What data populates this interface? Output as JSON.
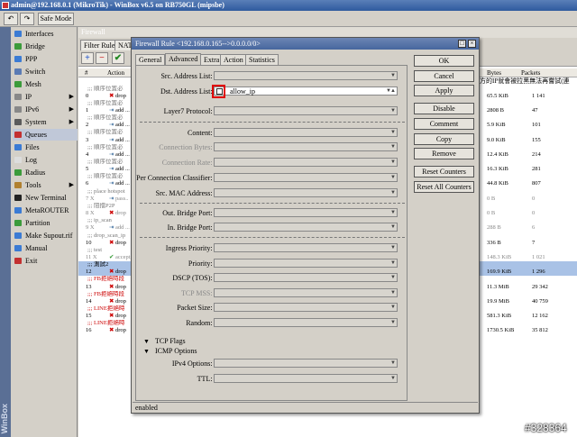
{
  "window_title": "admin@192.168.0.1 (MikroTik) - WinBox v6.5 on RB750GL (mipsbe)",
  "toolbar": {
    "safe_mode": "Safe Mode"
  },
  "sidebar": {
    "brand": "WinBox",
    "items": [
      {
        "label": "Interfaces",
        "icon": "interfaces-icon",
        "color": "#3b7bd4"
      },
      {
        "label": "Bridge",
        "icon": "bridge-icon",
        "color": "#3b9b3b"
      },
      {
        "label": "PPP",
        "icon": "ppp-icon",
        "color": "#3b7bd4"
      },
      {
        "label": "Switch",
        "icon": "switch-icon",
        "color": "#5b7bb4"
      },
      {
        "label": "Mesh",
        "icon": "mesh-icon",
        "color": "#3b9b3b"
      },
      {
        "label": "IP",
        "icon": "ip-icon",
        "color": "#888888",
        "arrow": true
      },
      {
        "label": "IPv6",
        "icon": "ipv6-icon",
        "color": "#888888",
        "arrow": true
      },
      {
        "label": "System",
        "icon": "system-icon",
        "color": "#5b5b5b",
        "arrow": true
      },
      {
        "label": "Queues",
        "icon": "queues-icon",
        "color": "#c33030",
        "selected": true
      },
      {
        "label": "Files",
        "icon": "files-icon",
        "color": "#3b7bd4"
      },
      {
        "label": "Log",
        "icon": "log-icon",
        "color": "#dddddd"
      },
      {
        "label": "Radius",
        "icon": "radius-icon",
        "color": "#3b9b3b"
      },
      {
        "label": "Tools",
        "icon": "tools-icon",
        "color": "#b08030",
        "arrow": true
      },
      {
        "label": "New Terminal",
        "icon": "terminal-icon",
        "color": "#222222"
      },
      {
        "label": "MetaROUTER",
        "icon": "metarouter-icon",
        "color": "#3b7bd4"
      },
      {
        "label": "Partition",
        "icon": "partition-icon",
        "color": "#3b9b3b"
      },
      {
        "label": "Make Supout.rif",
        "icon": "supout-icon",
        "color": "#3b7bd4"
      },
      {
        "label": "Manual",
        "icon": "manual-icon",
        "color": "#3b7bd4"
      },
      {
        "label": "Exit",
        "icon": "exit-icon",
        "color": "#c33030"
      }
    ]
  },
  "background_window": {
    "title": "Firewall",
    "tabs": [
      "Filter Rules",
      "NAT"
    ],
    "columns": {
      "hash": "#",
      "action": "Action",
      "bytes": "Bytes",
      "packets": "Packets"
    },
    "right_comment": "方的IP就會被拉黑無法再嘗試(連",
    "rows": [
      {
        "kind": "comment",
        "text": ";;; 順序位置必"
      },
      {
        "kind": "rule",
        "num": "0",
        "action": "drop",
        "bytes": "65.5 KiB",
        "packets": "1 141"
      },
      {
        "kind": "comment",
        "text": ";;; 順序位置必"
      },
      {
        "kind": "rule",
        "num": "1",
        "action": "add ...",
        "bytes": "2808 B",
        "packets": "47"
      },
      {
        "kind": "comment",
        "text": ";;; 順序位置必"
      },
      {
        "kind": "rule",
        "num": "2",
        "action": "add ...",
        "bytes": "5.9 KiB",
        "packets": "101"
      },
      {
        "kind": "comment",
        "text": ";;; 順序位置必"
      },
      {
        "kind": "rule",
        "num": "3",
        "action": "add ...",
        "bytes": "9.0 KiB",
        "packets": "155"
      },
      {
        "kind": "comment",
        "text": ";;; 順序位置必"
      },
      {
        "kind": "rule",
        "num": "4",
        "action": "add ...",
        "bytes": "12.4 KiB",
        "packets": "214"
      },
      {
        "kind": "comment",
        "text": ";;; 順序位置必"
      },
      {
        "kind": "rule",
        "num": "5",
        "action": "add ...",
        "bytes": "16.3 KiB",
        "packets": "281"
      },
      {
        "kind": "comment",
        "text": ";;; 順序位置必"
      },
      {
        "kind": "rule",
        "num": "6",
        "action": "add ...",
        "bytes": "44.8 KiB",
        "packets": "807"
      },
      {
        "kind": "comment",
        "text": ";;; place hotspot"
      },
      {
        "kind": "grey",
        "num": "7 X",
        "action": "pass..",
        "bytes": "0 B",
        "packets": "0"
      },
      {
        "kind": "comment",
        "text": ";;; 阻擋P2P"
      },
      {
        "kind": "grey",
        "num": "8 X",
        "action": "drop",
        "bytes": "0 B",
        "packets": "0"
      },
      {
        "kind": "comment",
        "text": ";;; ip_scan"
      },
      {
        "kind": "grey",
        "num": "9 X",
        "action": "add ...",
        "bytes": "288 B",
        "packets": "6"
      },
      {
        "kind": "comment",
        "text": ";;; drop_scan_ip"
      },
      {
        "kind": "rule",
        "num": "10",
        "action": "drop",
        "bytes": "336 B",
        "packets": "7"
      },
      {
        "kind": "comment",
        "text": ";;; test"
      },
      {
        "kind": "grey",
        "num": "11 X",
        "action": "accept",
        "bytes": "148.3 KiB",
        "packets": "1 021"
      },
      {
        "kind": "sel",
        "text": ";;; 測試2"
      },
      {
        "kind": "sel",
        "num": "12",
        "action": "drop",
        "bytes": "169.9 KiB",
        "packets": "1 296"
      },
      {
        "kind": "red",
        "text": ";;; FB拒絕時段"
      },
      {
        "kind": "rule",
        "num": "13",
        "action": "drop",
        "bytes": "11.3 MiB",
        "packets": "29 342"
      },
      {
        "kind": "red",
        "text": ";;; FB拒絕時段"
      },
      {
        "kind": "rule",
        "num": "14",
        "action": "drop",
        "bytes": "19.9 MiB",
        "packets": "40 759"
      },
      {
        "kind": "red",
        "text": ";;; LINE拒絕時"
      },
      {
        "kind": "rule",
        "num": "15",
        "action": "drop",
        "bytes": "581.3 KiB",
        "packets": "12 162"
      },
      {
        "kind": "red",
        "text": ";;; LINE拒絕時"
      },
      {
        "kind": "rule",
        "num": "16",
        "action": "drop",
        "bytes": "1730.5 KiB",
        "packets": "35 812"
      }
    ]
  },
  "dialog": {
    "title": "Firewall Rule <192.168.0.165-->0.0.0.0/0>",
    "tabs": [
      "General",
      "Advanced",
      "Extra",
      "Action",
      "Statistics"
    ],
    "active_tab": "Advanced",
    "fields": {
      "src_address_list": "Src. Address List:",
      "dst_address_list": "Dst. Address List:",
      "dst_address_list_value": "allow_ip",
      "layer7": "Layer7 Protocol:",
      "content": "Content:",
      "conn_bytes": "Connection Bytes:",
      "conn_rate": "Connection Rate:",
      "per_conn_classifier": "Per Connection Classifier:",
      "src_mac": "Src. MAC Address:",
      "out_bridge_port": "Out. Bridge Port:",
      "in_bridge_port": "In. Bridge Port:",
      "ingress_priority": "Ingress Priority:",
      "priority": "Priority:",
      "dscp": "DSCP (TOS):",
      "tcp_mss": "TCP MSS:",
      "packet_size": "Packet Size:",
      "random": "Random:",
      "ipv4_options": "IPv4 Options:",
      "ttl": "TTL:"
    },
    "sections": {
      "tcp_flags": "TCP Flags",
      "icmp_options": "ICMP Options"
    },
    "buttons": [
      "OK",
      "Cancel",
      "Apply",
      "Disable",
      "Comment",
      "Copy",
      "Remove",
      "Reset Counters",
      "Reset All Counters"
    ],
    "status": "enabled"
  },
  "watermark": "#328364",
  "colors": {
    "highlight_box": "#e00000",
    "selected_row": "#a9c2e6",
    "title_blue": "#47679e"
  }
}
